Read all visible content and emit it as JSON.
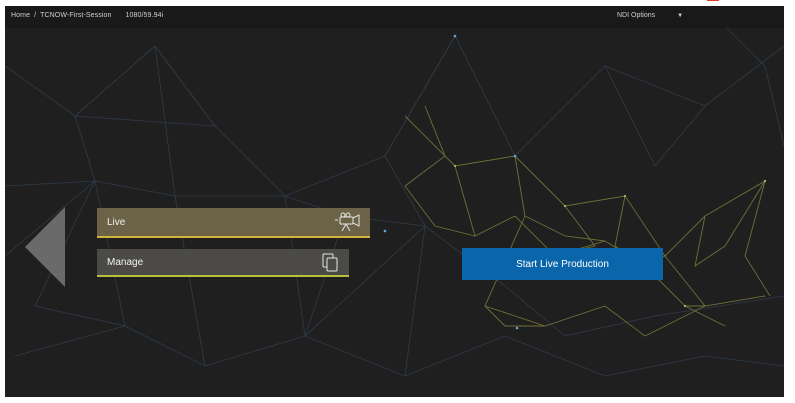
{
  "breadcrumb": {
    "home": "Home",
    "separator": "/",
    "session": "TCNOW-First-Session",
    "format": "1080/59.94i"
  },
  "ndi_options": {
    "label": "NDI Options"
  },
  "menu": {
    "live": {
      "label": "Live",
      "icon": "camera-icon"
    },
    "manage": {
      "label": "Manage",
      "icon": "copy-pages-icon"
    }
  },
  "actions": {
    "start_label": "Start Live Production"
  },
  "colors": {
    "background": "#1f1f1f",
    "topbar": "#191919",
    "live_button": "#6b6247",
    "live_accent": "#d2b43a",
    "manage_button": "#4b4a46",
    "manage_accent": "#b7c23a",
    "start_button": "#0b65aa"
  }
}
